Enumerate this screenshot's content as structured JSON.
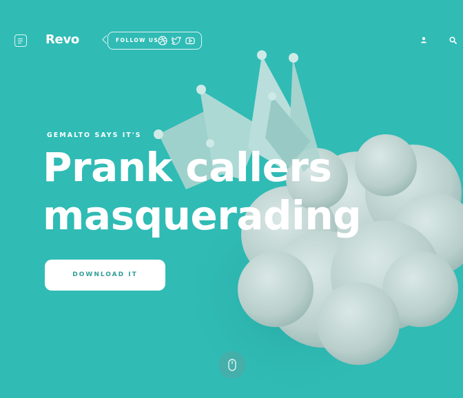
{
  "brand": {
    "name": "Revo"
  },
  "header": {
    "follow_label": "FOLLOW US",
    "social_icons": [
      "dribbble-icon",
      "twitter-icon",
      "youtube-icon"
    ]
  },
  "hero": {
    "eyebrow": "GEMALTO SAYS IT'S",
    "headline_line1": "Prank callers",
    "headline_line2": "masquerading",
    "cta_label": "DOWNLOAD IT"
  },
  "colors": {
    "background": "#30bbb5",
    "cta_text": "#2f9d98",
    "foreground": "#ffffff"
  }
}
